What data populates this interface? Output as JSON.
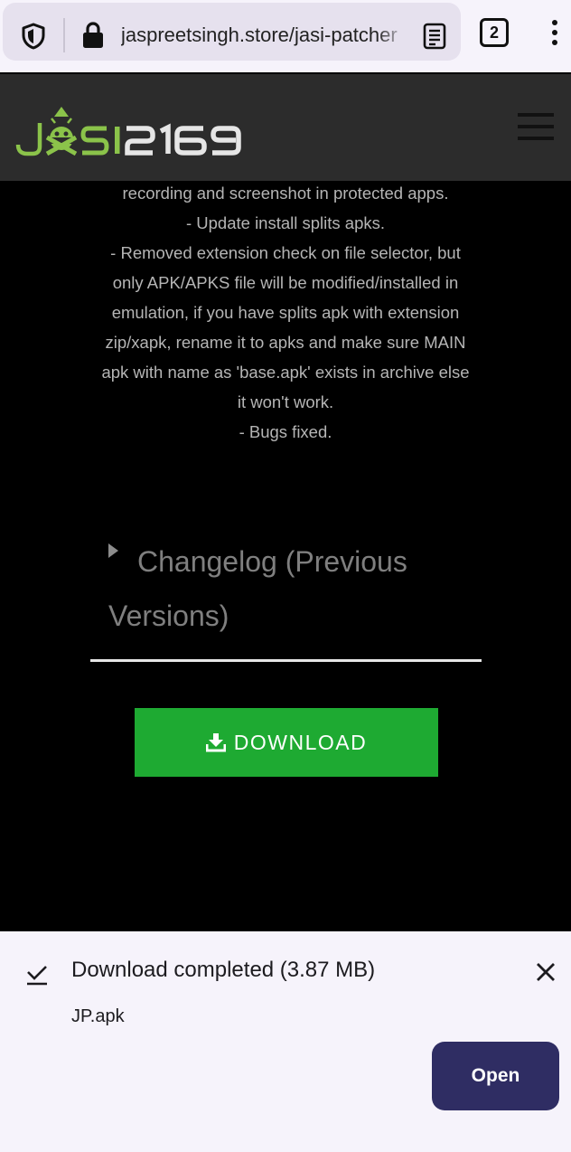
{
  "browser": {
    "url": "jaspreetsingh.store/jasi-patcher",
    "tab_count": "2",
    "icons": [
      "shield-icon",
      "lock-icon",
      "reader-mode-icon",
      "tabs-icon",
      "more-vert-icon"
    ]
  },
  "site": {
    "logo_text": "JASI2169",
    "logo_colors": {
      "accent": "#8bc34a",
      "mono": "#e6e6e6"
    },
    "menu_icon": "hamburger-icon"
  },
  "changelog": {
    "lines": [
      "recording and screenshot in protected apps.",
      "- Update install splits apks.",
      "- Removed extension check on file selector, but",
      "only APK/APKS file will be modified/installed in",
      "emulation, if you have splits apk with extension",
      "zip/xapk, rename it to apks and make sure MAIN",
      "apk with name as 'base.apk' exists in archive else",
      "it won't work.",
      "- Bugs fixed."
    ],
    "previous_versions_line1": "Changelog (Previous",
    "previous_versions_line2": "Versions)"
  },
  "download_button": {
    "label": "DOWNLOAD",
    "icon": "download-icon",
    "color": "#1eaa32"
  },
  "snackbar": {
    "title": "Download completed (3.87 MB)",
    "filename": "JP.apk",
    "open_label": "Open",
    "icons": [
      "check-icon",
      "close-icon"
    ],
    "button_color": "#2f2d63"
  }
}
